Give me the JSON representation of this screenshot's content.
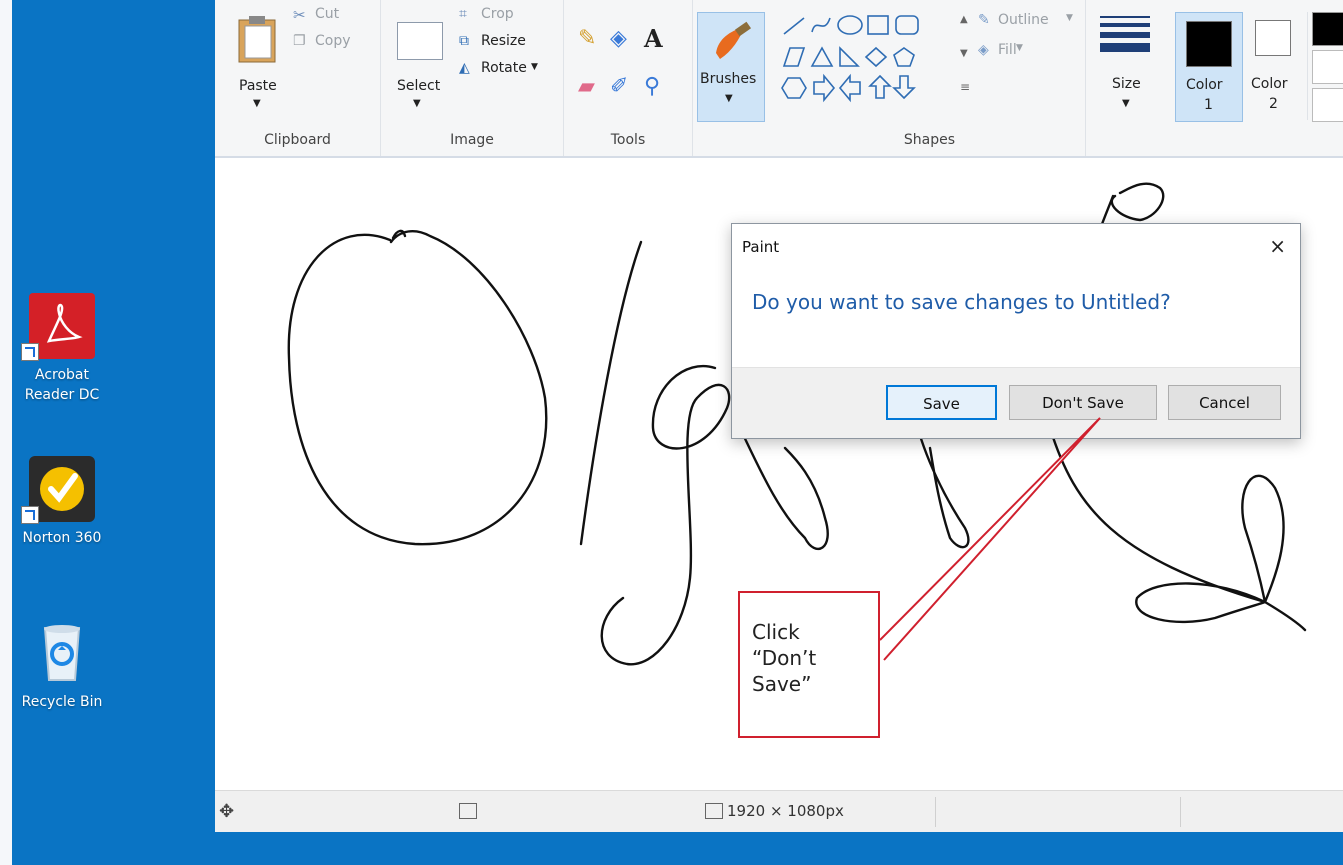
{
  "desktop": {
    "icons": [
      {
        "label_line1": "Acrobat",
        "label_line2": "Reader DC",
        "icon": "acrobat-reader-icon"
      },
      {
        "label": "Norton 360",
        "icon": "norton-360-icon"
      },
      {
        "label": "Recycle Bin",
        "icon": "recycle-bin-icon"
      }
    ]
  },
  "ribbon": {
    "clipboard": {
      "title": "Clipboard",
      "paste": "Paste",
      "cut": "Cut",
      "copy": "Copy"
    },
    "image": {
      "title": "Image",
      "select": "Select",
      "crop": "Crop",
      "resize": "Resize",
      "rotate": "Rotate"
    },
    "tools": {
      "title": "Tools"
    },
    "brushes": {
      "label": "Brushes"
    },
    "shapes": {
      "title": "Shapes",
      "outline": "Outline",
      "fill": "Fill"
    },
    "size": {
      "label": "Size"
    },
    "color1": {
      "line1": "Color",
      "line2": "1",
      "value": "#000000"
    },
    "color2": {
      "line1": "Color",
      "line2": "2",
      "value": "#ffffff"
    }
  },
  "statusbar": {
    "canvas_size": "1920 × 1080px"
  },
  "dialog": {
    "title": "Paint",
    "close": "×",
    "message": "Do you want to save changes to Untitled?",
    "buttons": {
      "save": "Save",
      "dont_save": "Don't Save",
      "cancel": "Cancel"
    }
  },
  "callout": {
    "line1": "Click",
    "line2": "“Don’t",
    "line3": "Save”"
  },
  "colors": {
    "desktop": "#0a74c4",
    "accent": "#0078d7",
    "callout_border": "#d0202e",
    "message_text": "#1f5ca8"
  }
}
